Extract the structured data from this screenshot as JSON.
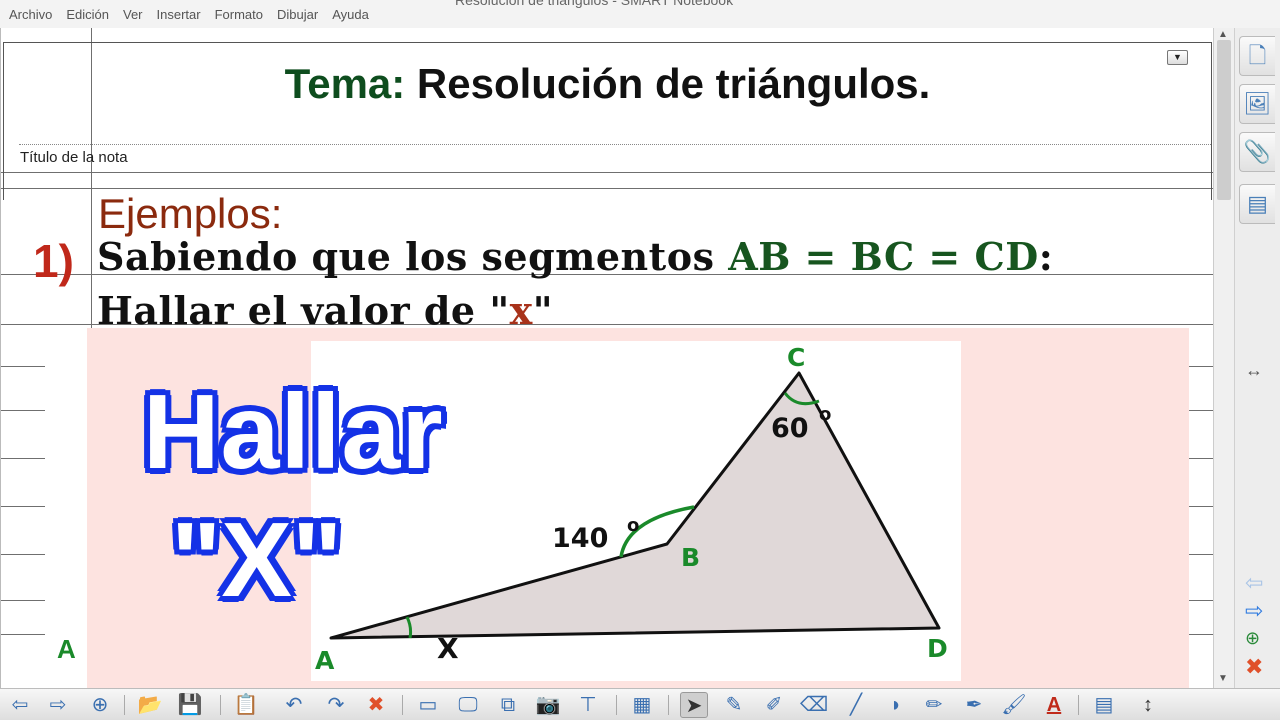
{
  "window": {
    "title": "Resolución de triángulos - SMART Notebook"
  },
  "menu": [
    "Archivo",
    "Edición",
    "Ver",
    "Insertar",
    "Formato",
    "Dibujar",
    "Ayuda"
  ],
  "note": {
    "title_prefix": "Tema:",
    "title_rest": " Resolución de triángulos.",
    "label": "Título de la nota",
    "dropdown_symbol": "▼"
  },
  "content": {
    "heading": "Ejemplos:",
    "problem_number": "1)",
    "line1_text": "Sabiendo que los segmentos ",
    "line1_segments": "AB = BC = CD",
    "line1_end": ":",
    "line2_text": "Hallar el valor de \"",
    "line2_var": "x",
    "line2_end": "\"",
    "stray_label": "A"
  },
  "overlay": {
    "word1": "Hallar",
    "word2": "\"X\""
  },
  "diagram": {
    "vertices": {
      "A": "A",
      "B": "B",
      "C": "C",
      "D": "D"
    },
    "angle_B": "140",
    "angle_C": "60",
    "unknown": "X",
    "degree": "o",
    "colors": {
      "fill": "#e0d8d8",
      "stroke": "#111111",
      "arc": "#1a8a2a",
      "label": "#1a8a2a"
    }
  },
  "sidebar": {
    "tabs": [
      {
        "name": "page-sorter-tab",
        "icon": "page-icon",
        "glyph": "🗋"
      },
      {
        "name": "gallery-tab",
        "icon": "gallery-icon",
        "glyph": "🖼"
      },
      {
        "name": "attachments-tab",
        "icon": "paperclip-icon",
        "glyph": "📎"
      },
      {
        "name": "properties-tab",
        "icon": "properties-icon",
        "glyph": "▤"
      }
    ],
    "resize_symbol": "↔"
  },
  "toolbar": {
    "items": [
      {
        "name": "back-button",
        "glyph": "⇦"
      },
      {
        "name": "forward-button",
        "glyph": "⇨"
      },
      {
        "name": "add-page-button",
        "glyph": "⊕"
      },
      {
        "name": "open-file-button",
        "glyph": "📂"
      },
      {
        "name": "save-button",
        "glyph": "💾"
      },
      {
        "name": "paste-button",
        "glyph": "📋"
      },
      {
        "name": "undo-button",
        "glyph": "↶"
      },
      {
        "name": "redo-button",
        "glyph": "↷"
      },
      {
        "name": "delete-button",
        "glyph": "✖"
      },
      {
        "name": "screen-shade-button",
        "glyph": "▭"
      },
      {
        "name": "full-screen-button",
        "glyph": "🖵"
      },
      {
        "name": "dual-page-button",
        "glyph": "⧉"
      },
      {
        "name": "capture-button",
        "glyph": "📷"
      },
      {
        "name": "document-camera-button",
        "glyph": "⊤"
      },
      {
        "name": "table-button",
        "glyph": "▦"
      },
      {
        "name": "select-tool",
        "glyph": "➤"
      },
      {
        "name": "pen-tool",
        "glyph": "✎"
      },
      {
        "name": "creative-pen-tool",
        "glyph": "✐"
      },
      {
        "name": "eraser-tool",
        "glyph": "⌫"
      },
      {
        "name": "line-tool",
        "glyph": "╱"
      },
      {
        "name": "shape-tool",
        "glyph": "◗"
      },
      {
        "name": "magic-pen-tool",
        "glyph": "✏"
      },
      {
        "name": "shape-recognition-pen-tool",
        "glyph": "✒"
      },
      {
        "name": "fill-tool",
        "glyph": "🖌"
      },
      {
        "name": "text-tool",
        "glyph": "A"
      },
      {
        "name": "properties-button",
        "glyph": "▤"
      },
      {
        "name": "move-toolbar-button",
        "glyph": "↕"
      }
    ]
  }
}
